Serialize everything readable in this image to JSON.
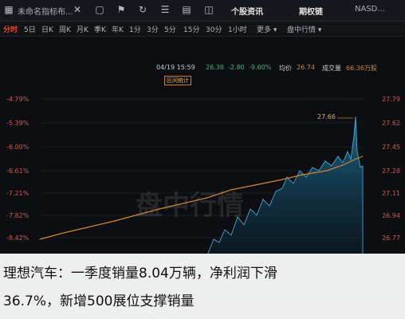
{
  "topbar": {
    "left_title": "未命名指标布...",
    "page_title": "个股资讯",
    "stock_name": "期权链",
    "exchange": "NASD..."
  },
  "tabs": [
    {
      "label": "分时",
      "active": true
    },
    {
      "label": "5日"
    },
    {
      "label": "日K"
    },
    {
      "label": "周K"
    },
    {
      "label": "月K"
    },
    {
      "label": "季K"
    },
    {
      "label": "年K"
    },
    {
      "label": "1分"
    },
    {
      "label": "3分"
    },
    {
      "label": "5分"
    },
    {
      "label": "15分"
    },
    {
      "label": "30分"
    },
    {
      "label": "1小时"
    },
    {
      "label": "更多 ▾"
    },
    {
      "label": "盘中行情 ▾"
    }
  ],
  "info": {
    "time": "04/19 15:59",
    "price_label": "26.38",
    "change": "-2.80",
    "change_pct": "-9.60%",
    "avg_label": "均价",
    "avg_value": "26.74",
    "volume_label": "成交量",
    "volume_value": "66.36万股",
    "stats_button": "区间统计"
  },
  "axis_left": [
    "-4.79%",
    "-5.39%",
    "-6.00%",
    "-6.61%",
    "-7.21%",
    "-7.82%",
    "-8.42%"
  ],
  "axis_right": [
    "27.79",
    "27.62",
    "27.45",
    "27.28",
    "27.11",
    "26.94",
    "26.77"
  ],
  "high_marker": "27.66",
  "watermark": "盘中行情",
  "caption": {
    "line1": "理想汽车：一季度销量8.04万辆，净利润下滑",
    "line2": "36.7%，新增500展位支撑销量"
  },
  "colors": {
    "accent": "#e24a35",
    "avg_line": "#d4862d",
    "price_area": "#1b6b8f"
  }
}
